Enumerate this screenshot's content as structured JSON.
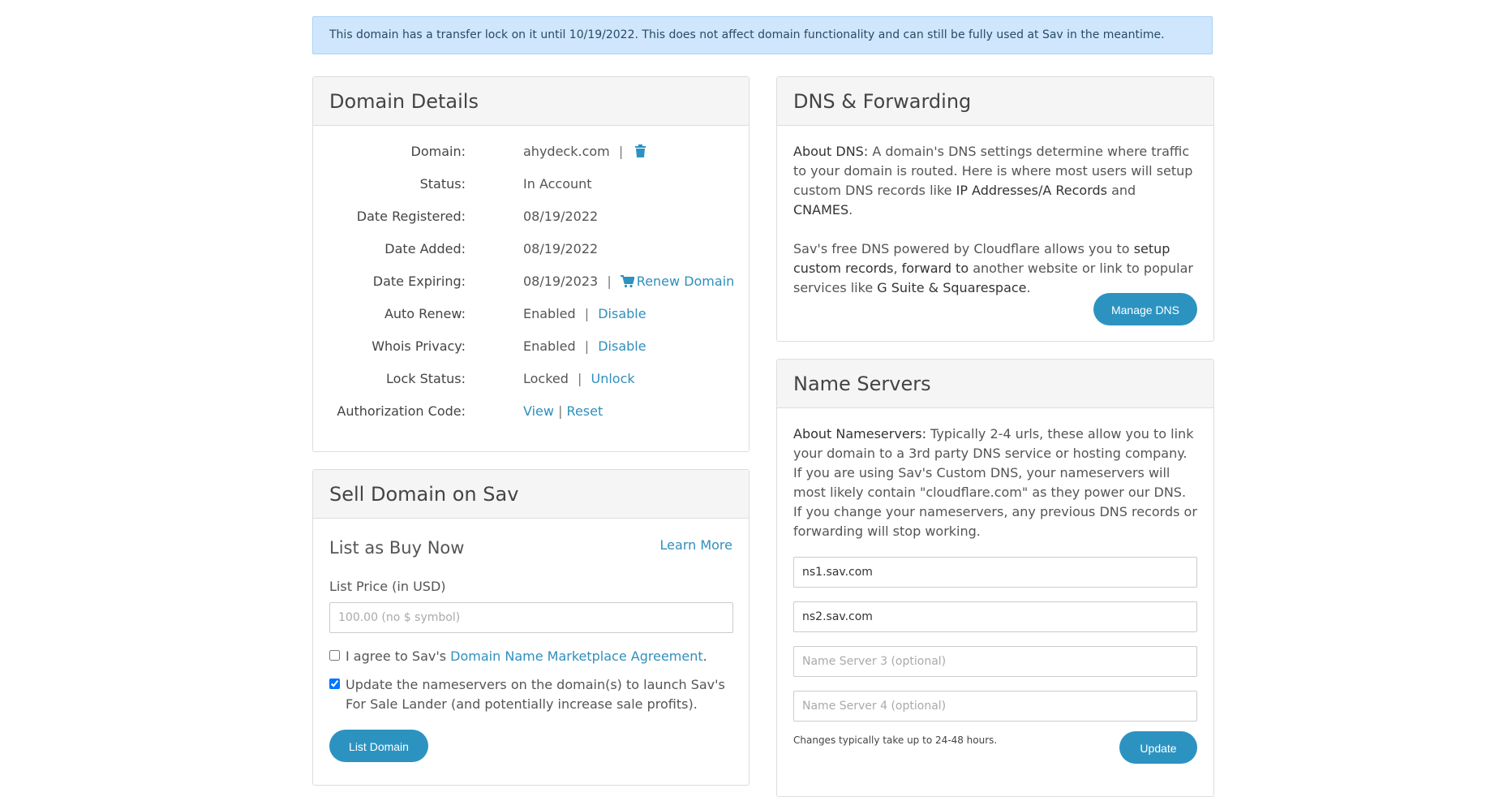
{
  "alert": {
    "text": "This domain has a transfer lock on it until 10/19/2022. This does not affect domain functionality and can still be fully used at Sav in the meantime."
  },
  "details": {
    "title": "Domain Details",
    "domain_label": "Domain:",
    "domain_value": "ahydeck.com",
    "status_label": "Status:",
    "status_value": "In Account",
    "registered_label": "Date Registered:",
    "registered_value": "08/19/2022",
    "added_label": "Date Added:",
    "added_value": "08/19/2022",
    "expiring_label": "Date Expiring:",
    "expiring_value": "08/19/2023",
    "renew_link": "Renew Domain",
    "autorenew_label": "Auto Renew:",
    "autorenew_value": "Enabled",
    "autorenew_link": "Disable",
    "whois_label": "Whois Privacy:",
    "whois_value": "Enabled",
    "whois_link": "Disable",
    "lock_label": "Lock Status:",
    "lock_value": "Locked",
    "lock_link": "Unlock",
    "auth_label": "Authorization Code:",
    "auth_view": "View",
    "auth_reset": "Reset",
    "separator": "|",
    "icons": {
      "delete": "trash-icon",
      "renew": "cart-icon"
    },
    "accent_color": "#2c93c1"
  },
  "sell": {
    "title": "Sell Domain on Sav",
    "subtitle": "List as Buy Now",
    "learn_more": "Learn More",
    "price_label": "List Price (in USD)",
    "price_placeholder": "100.00 (no $ symbol)",
    "agree_prefix": "I agree to Sav's ",
    "agree_link": "Domain Name Marketplace Agreement",
    "agree_suffix": ".",
    "agree_checked": false,
    "update_ns_text": "Update the nameservers on the domain(s) to launch Sav's For Sale Lander (and potentially increase sale profits).",
    "update_ns_checked": true,
    "button": "List Domain"
  },
  "dns": {
    "title": "DNS & Forwarding",
    "about_bold": "About DNS:",
    "about_text_1": " A domain's DNS settings determine where traffic to your domain is routed. Here is where most users will setup custom DNS records like ",
    "about_bold_2": "IP Addresses/A Records",
    "about_text_2": " and ",
    "about_bold_3": "CNAMES",
    "about_text_3": ".",
    "p2_text_1": "Sav's free DNS powered by Cloudflare allows you to ",
    "p2_bold_1": "setup custom records",
    "p2_text_2": ", ",
    "p2_bold_2": "forward to",
    "p2_text_3": " another website or link to popular services like ",
    "p2_bold_3": "G Suite & Squarespace",
    "p2_text_4": ".",
    "button": "Manage DNS"
  },
  "ns": {
    "title": "Name Servers",
    "about_bold": "About Nameservers:",
    "about_text": " Typically 2-4 urls, these allow you to link your domain to a 3rd party DNS service or hosting company. If you are using Sav's Custom DNS, your nameservers will most likely contain \"cloudflare.com\" as they power our DNS. If you change your nameservers, any previous DNS records or forwarding will stop working.",
    "ns1_value": "ns1.sav.com",
    "ns2_value": "ns2.sav.com",
    "ns3_placeholder": "Name Server 3 (optional)",
    "ns4_placeholder": "Name Server 4 (optional)",
    "note": "Changes typically take up to 24-48 hours.",
    "button": "Update"
  }
}
